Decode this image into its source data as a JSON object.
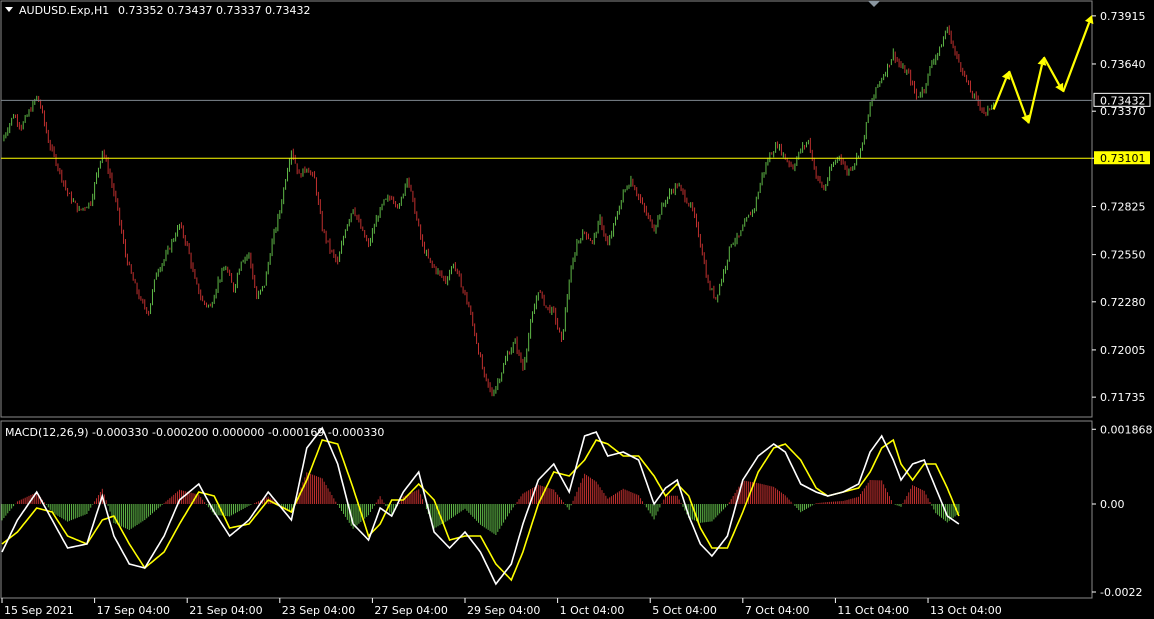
{
  "header": {
    "symbol": "AUDUSD.Exp,H1",
    "ohlc": "0.73352 0.73437 0.73337 0.73432"
  },
  "macd": {
    "label": "MACD(12,26,9) -0.000330 -0.000200 0.000000 -0.000169 -0.000330"
  },
  "colors": {
    "background": "#000000",
    "bull": "#5fb847",
    "bear": "#c0302f",
    "current_price_line": "#7f8890",
    "level_line": "#ffff00",
    "macd_main": "#ffffff",
    "macd_signal": "#ffff00",
    "forecast_arrow": "#ffff00"
  },
  "chart_data": [
    {
      "type": "candlestick",
      "title": "",
      "price_ticks": [
        "0.73915",
        "0.73640",
        "0.73370",
        "0.73101",
        "0.72825",
        "0.72550",
        "0.72280",
        "0.72005",
        "0.71735"
      ],
      "ylim": [
        0.7165,
        0.7396
      ],
      "current_price": {
        "value": 0.73432,
        "label": "0.73432"
      },
      "level_line": {
        "value": 0.73101,
        "label": "0.73101"
      },
      "time_labels": [
        "15 Sep 2021",
        "17 Sep 04:00",
        "21 Sep 04:00",
        "23 Sep 04:00",
        "27 Sep 04:00",
        "29 Sep 04:00",
        "1 Oct 04:00",
        "5 Oct 04:00",
        "7 Oct 04:00",
        "11 Oct 04:00",
        "13 Oct 04:00"
      ],
      "close_path": [
        [
          0,
          0.732
        ],
        [
          6,
          0.7335
        ],
        [
          10,
          0.7328
        ],
        [
          18,
          0.7345
        ],
        [
          20,
          0.734
        ],
        [
          24,
          0.732
        ],
        [
          28,
          0.7308
        ],
        [
          34,
          0.729
        ],
        [
          40,
          0.728
        ],
        [
          46,
          0.7285
        ],
        [
          52,
          0.7315
        ],
        [
          56,
          0.73
        ],
        [
          60,
          0.728
        ],
        [
          64,
          0.7255
        ],
        [
          68,
          0.724
        ],
        [
          72,
          0.7228
        ],
        [
          76,
          0.7222
        ],
        [
          80,
          0.7245
        ],
        [
          84,
          0.7252
        ],
        [
          88,
          0.7262
        ],
        [
          92,
          0.7272
        ],
        [
          96,
          0.726
        ],
        [
          100,
          0.724
        ],
        [
          104,
          0.7228
        ],
        [
          108,
          0.7225
        ],
        [
          112,
          0.724
        ],
        [
          116,
          0.7248
        ],
        [
          120,
          0.7235
        ],
        [
          124,
          0.7252
        ],
        [
          128,
          0.7255
        ],
        [
          132,
          0.723
        ],
        [
          136,
          0.7238
        ],
        [
          140,
          0.7262
        ],
        [
          144,
          0.728
        ],
        [
          148,
          0.7305
        ],
        [
          150,
          0.7315
        ],
        [
          154,
          0.73
        ],
        [
          158,
          0.7305
        ],
        [
          162,
          0.7298
        ],
        [
          166,
          0.727
        ],
        [
          170,
          0.7258
        ],
        [
          174,
          0.725
        ],
        [
          178,
          0.727
        ],
        [
          182,
          0.7282
        ],
        [
          186,
          0.727
        ],
        [
          190,
          0.726
        ],
        [
          194,
          0.7275
        ],
        [
          198,
          0.7285
        ],
        [
          202,
          0.7288
        ],
        [
          206,
          0.7282
        ],
        [
          210,
          0.73
        ],
        [
          214,
          0.728
        ],
        [
          218,
          0.726
        ],
        [
          222,
          0.725
        ],
        [
          226,
          0.7245
        ],
        [
          230,
          0.724
        ],
        [
          234,
          0.725
        ],
        [
          238,
          0.7238
        ],
        [
          242,
          0.7225
        ],
        [
          246,
          0.7205
        ],
        [
          250,
          0.7185
        ],
        [
          254,
          0.7175
        ],
        [
          258,
          0.7185
        ],
        [
          262,
          0.7198
        ],
        [
          266,
          0.7205
        ],
        [
          270,
          0.719
        ],
        [
          274,
          0.7215
        ],
        [
          278,
          0.7235
        ],
        [
          282,
          0.7225
        ],
        [
          286,
          0.7222
        ],
        [
          290,
          0.7205
        ],
        [
          294,
          0.724
        ],
        [
          298,
          0.7262
        ],
        [
          302,
          0.7268
        ],
        [
          306,
          0.7262
        ],
        [
          310,
          0.7275
        ],
        [
          314,
          0.726
        ],
        [
          318,
          0.7275
        ],
        [
          322,
          0.729
        ],
        [
          326,
          0.7298
        ],
        [
          330,
          0.7288
        ],
        [
          334,
          0.7278
        ],
        [
          338,
          0.727
        ],
        [
          342,
          0.7282
        ],
        [
          346,
          0.729
        ],
        [
          350,
          0.7295
        ],
        [
          354,
          0.7288
        ],
        [
          358,
          0.728
        ],
        [
          362,
          0.7262
        ],
        [
          366,
          0.7238
        ],
        [
          370,
          0.723
        ],
        [
          374,
          0.7245
        ],
        [
          378,
          0.7262
        ],
        [
          382,
          0.7265
        ],
        [
          386,
          0.7275
        ],
        [
          390,
          0.7282
        ],
        [
          394,
          0.73
        ],
        [
          398,
          0.7312
        ],
        [
          402,
          0.7318
        ],
        [
          406,
          0.731
        ],
        [
          410,
          0.7305
        ],
        [
          414,
          0.7315
        ],
        [
          418,
          0.732
        ],
        [
          422,
          0.73
        ],
        [
          426,
          0.7292
        ],
        [
          430,
          0.7305
        ],
        [
          434,
          0.7312
        ],
        [
          438,
          0.7302
        ],
        [
          442,
          0.7308
        ],
        [
          446,
          0.7318
        ],
        [
          450,
          0.734
        ],
        [
          454,
          0.7352
        ],
        [
          458,
          0.736
        ],
        [
          462,
          0.737
        ],
        [
          466,
          0.7362
        ],
        [
          470,
          0.7358
        ],
        [
          474,
          0.7345
        ],
        [
          478,
          0.735
        ],
        [
          482,
          0.7365
        ],
        [
          486,
          0.7372
        ],
        [
          490,
          0.7385
        ],
        [
          494,
          0.737
        ],
        [
          498,
          0.736
        ],
        [
          502,
          0.7348
        ],
        [
          506,
          0.7342
        ],
        [
          510,
          0.7335
        ],
        [
          514,
          0.7343
        ]
      ],
      "forecast_arrow": [
        [
          514,
          0.7338
        ],
        [
          522,
          0.736
        ],
        [
          532,
          0.733
        ],
        [
          540,
          0.7368
        ],
        [
          550,
          0.7348
        ],
        [
          565,
          0.7392
        ]
      ]
    },
    {
      "type": "macd",
      "title": "",
      "ticks": [
        "0.001868",
        "0.00",
        "-0.0022"
      ],
      "ylim": [
        -0.0023,
        0.002
      ],
      "series": [
        {
          "name": "MACD",
          "points": [
            [
              0,
              -0.0012
            ],
            [
              8,
              -0.0004
            ],
            [
              18,
              0.0003
            ],
            [
              26,
              -0.0004
            ],
            [
              34,
              -0.0011
            ],
            [
              44,
              -0.001
            ],
            [
              52,
              0.0002
            ],
            [
              58,
              -0.0008
            ],
            [
              66,
              -0.0015
            ],
            [
              74,
              -0.0016
            ],
            [
              84,
              -0.0008
            ],
            [
              92,
              0.0001
            ],
            [
              102,
              0.0005
            ],
            [
              110,
              -0.0002
            ],
            [
              118,
              -0.0008
            ],
            [
              128,
              -0.0004
            ],
            [
              138,
              0.0003
            ],
            [
              150,
              -0.0004
            ],
            [
              158,
              0.0014
            ],
            [
              166,
              0.0019
            ],
            [
              174,
              0.001
            ],
            [
              182,
              -0.0005
            ],
            [
              190,
              -0.0009
            ],
            [
              196,
              -0.0001
            ],
            [
              202,
              -0.0003
            ],
            [
              208,
              0.0003
            ],
            [
              216,
              0.0008
            ],
            [
              224,
              -0.0007
            ],
            [
              232,
              -0.0011
            ],
            [
              240,
              -0.0007
            ],
            [
              248,
              -0.0012
            ],
            [
              256,
              -0.002
            ],
            [
              264,
              -0.0015
            ],
            [
              270,
              -0.0005
            ],
            [
              278,
              0.0006
            ],
            [
              286,
              0.001
            ],
            [
              294,
              0.0003
            ],
            [
              302,
              0.0017
            ],
            [
              308,
              0.0018
            ],
            [
              314,
              0.0012
            ],
            [
              322,
              0.0013
            ],
            [
              330,
              0.0011
            ],
            [
              338,
              0.0
            ],
            [
              344,
              0.0004
            ],
            [
              350,
              0.0006
            ],
            [
              356,
              -0.0003
            ],
            [
              362,
              -0.001
            ],
            [
              368,
              -0.0013
            ],
            [
              376,
              -0.0008
            ],
            [
              384,
              0.0006
            ],
            [
              392,
              0.0012
            ],
            [
              400,
              0.0015
            ],
            [
              406,
              0.0013
            ],
            [
              414,
              0.0005
            ],
            [
              422,
              0.0003
            ],
            [
              428,
              0.0002
            ],
            [
              436,
              0.0003
            ],
            [
              444,
              0.0005
            ],
            [
              450,
              0.0013
            ],
            [
              456,
              0.0017
            ],
            [
              462,
              0.0011
            ],
            [
              466,
              0.0006
            ],
            [
              472,
              0.001
            ],
            [
              478,
              0.0011
            ],
            [
              484,
              0.0004
            ],
            [
              490,
              -0.0003
            ],
            [
              496,
              -0.0005
            ]
          ]
        },
        {
          "name": "Signal",
          "points": [
            [
              0,
              -0.001
            ],
            [
              8,
              -0.0007
            ],
            [
              18,
              -0.0001
            ],
            [
              26,
              -0.0002
            ],
            [
              34,
              -0.0008
            ],
            [
              44,
              -0.001
            ],
            [
              52,
              -0.0004
            ],
            [
              58,
              -0.0003
            ],
            [
              66,
              -0.001
            ],
            [
              74,
              -0.0016
            ],
            [
              84,
              -0.0012
            ],
            [
              92,
              -0.0005
            ],
            [
              102,
              0.0003
            ],
            [
              110,
              0.0002
            ],
            [
              118,
              -0.0006
            ],
            [
              128,
              -0.0005
            ],
            [
              138,
              0.0001
            ],
            [
              150,
              -0.0002
            ],
            [
              158,
              0.0006
            ],
            [
              166,
              0.0016
            ],
            [
              174,
              0.0015
            ],
            [
              182,
              0.0004
            ],
            [
              190,
              -0.0008
            ],
            [
              196,
              -0.0005
            ],
            [
              202,
              0.0001
            ],
            [
              208,
              0.0001
            ],
            [
              216,
              0.0005
            ],
            [
              224,
              0.0001
            ],
            [
              232,
              -0.0009
            ],
            [
              240,
              -0.0008
            ],
            [
              248,
              -0.0008
            ],
            [
              256,
              -0.0015
            ],
            [
              264,
              -0.0019
            ],
            [
              270,
              -0.0012
            ],
            [
              278,
              0.0
            ],
            [
              286,
              0.0008
            ],
            [
              294,
              0.0007
            ],
            [
              302,
              0.0011
            ],
            [
              308,
              0.0016
            ],
            [
              314,
              0.0015
            ],
            [
              322,
              0.0012
            ],
            [
              330,
              0.0012
            ],
            [
              338,
              0.0007
            ],
            [
              344,
              0.0002
            ],
            [
              350,
              0.0005
            ],
            [
              356,
              0.0002
            ],
            [
              362,
              -0.0006
            ],
            [
              368,
              -0.0011
            ],
            [
              376,
              -0.0011
            ],
            [
              384,
              -0.0002
            ],
            [
              392,
              0.0008
            ],
            [
              400,
              0.0014
            ],
            [
              406,
              0.0015
            ],
            [
              414,
              0.0011
            ],
            [
              422,
              0.0004
            ],
            [
              428,
              0.0002
            ],
            [
              436,
              0.0003
            ],
            [
              444,
              0.0004
            ],
            [
              450,
              0.0008
            ],
            [
              456,
              0.0014
            ],
            [
              462,
              0.0016
            ],
            [
              466,
              0.001
            ],
            [
              472,
              0.0006
            ],
            [
              478,
              0.001
            ],
            [
              484,
              0.001
            ],
            [
              490,
              0.0004
            ],
            [
              496,
              -0.0003
            ]
          ]
        }
      ]
    }
  ]
}
